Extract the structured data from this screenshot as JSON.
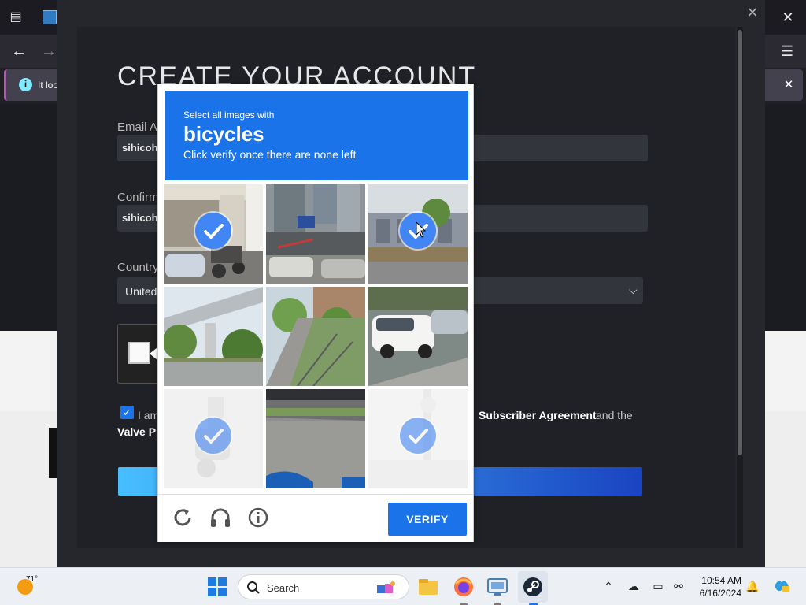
{
  "browser": {
    "notice_text": "It loo",
    "close_label": "✕",
    "menu_label": "☰"
  },
  "modal": {
    "title": "CREATE YOUR ACCOUNT",
    "email_label": "Email Ac",
    "email_value": "sihicoh",
    "confirm_label": "Confirm",
    "confirm_value": "sihicoh",
    "country_label": "Country",
    "country_value": "United",
    "agreement_prefix": "I am",
    "agreement_link_1": "Subscriber Agreement",
    "agreement_and": "and the",
    "agreement_link_2": "Valve Pr"
  },
  "captcha": {
    "select_text": "Select all images with",
    "target_word": "bicycles",
    "instruction": "Click verify once there are none left",
    "verify_label": "VERIFY",
    "tiles": [
      {
        "subject": "street-scooters-parked",
        "selected": true,
        "faded": false
      },
      {
        "subject": "storefront-with-cars",
        "selected": false,
        "faded": false
      },
      {
        "subject": "building-with-trees",
        "selected": true,
        "faded": false
      },
      {
        "subject": "elevated-highway",
        "selected": false,
        "faded": false
      },
      {
        "subject": "sidewalk-railing",
        "selected": false,
        "faded": false
      },
      {
        "subject": "white-car-parking",
        "selected": false,
        "faded": false
      },
      {
        "subject": "faded-scooter",
        "selected": true,
        "faded": true
      },
      {
        "subject": "road-corner",
        "selected": false,
        "faded": false
      },
      {
        "subject": "faded-pole",
        "selected": true,
        "faded": true
      }
    ]
  },
  "taskbar": {
    "weather_temp": "71°",
    "search_placeholder": "Search",
    "time": "10:54 AM",
    "date": "6/16/2024"
  },
  "colors": {
    "captcha_blue": "#1a73e8",
    "check_blue": "#4285f4",
    "steam_bg": "#25272d"
  }
}
